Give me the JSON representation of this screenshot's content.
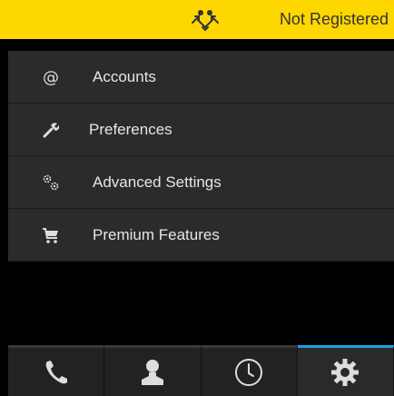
{
  "status_bar": {
    "registration_text": "Not Registered",
    "icon": "people-sync-icon",
    "background": "#ffd700"
  },
  "menu": {
    "items": [
      {
        "label": "Accounts",
        "icon": "at-icon"
      },
      {
        "label": "Preferences",
        "icon": "wrench-icon"
      },
      {
        "label": "Advanced Settings",
        "icon": "gears-icon"
      },
      {
        "label": "Premium Features",
        "icon": "cart-icon"
      }
    ]
  },
  "tabbar": {
    "tabs": [
      {
        "name": "phone",
        "icon": "phone-icon",
        "active": false
      },
      {
        "name": "contacts",
        "icon": "contact-icon",
        "active": false
      },
      {
        "name": "recent",
        "icon": "clock-icon",
        "active": false
      },
      {
        "name": "settings",
        "icon": "gear-icon",
        "active": true
      }
    ],
    "accent": "#1aa0dc"
  }
}
